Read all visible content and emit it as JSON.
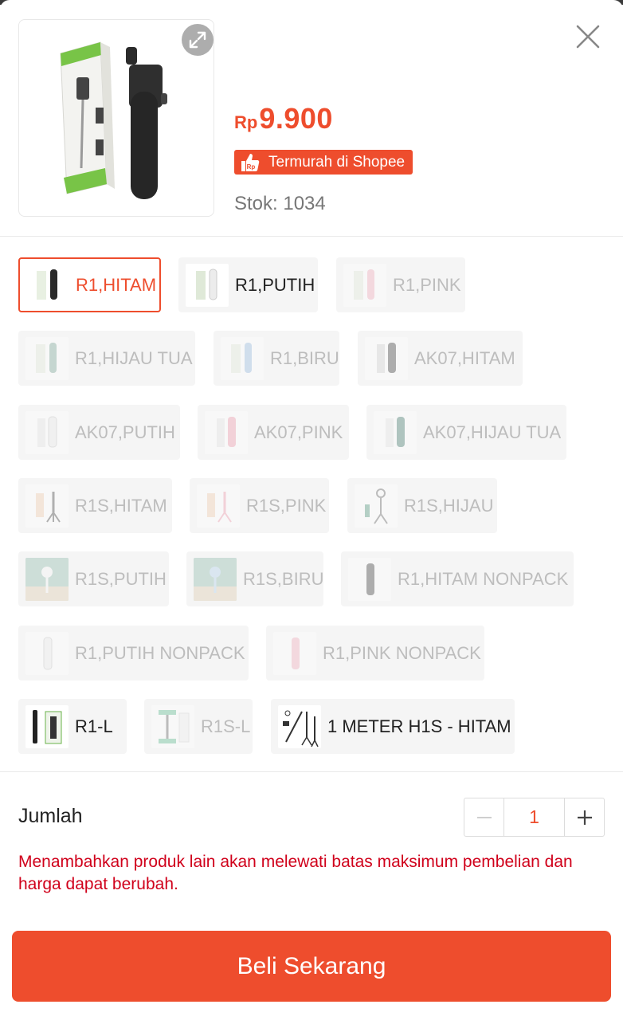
{
  "product": {
    "price_currency": "Rp",
    "price_value": "9.900",
    "badge_label": "Termurah di Shopee",
    "stock_text": "Stok: 1034"
  },
  "variations": [
    {
      "label": "R1,HITAM",
      "state": "selected"
    },
    {
      "label": "R1,PUTIH",
      "state": "available"
    },
    {
      "label": "R1,PINK",
      "state": "disabled"
    },
    {
      "label": "R1,HIJAU TUA",
      "state": "disabled"
    },
    {
      "label": "R1,BIRU",
      "state": "disabled"
    },
    {
      "label": "AK07,HITAM",
      "state": "disabled"
    },
    {
      "label": "AK07,PUTIH",
      "state": "disabled"
    },
    {
      "label": "AK07,PINK",
      "state": "disabled"
    },
    {
      "label": "AK07,HIJAU TUA",
      "state": "disabled"
    },
    {
      "label": "R1S,HITAM",
      "state": "disabled"
    },
    {
      "label": "R1S,PINK",
      "state": "disabled"
    },
    {
      "label": "R1S,HIJAU",
      "state": "disabled"
    },
    {
      "label": "R1S,PUTIH",
      "state": "disabled"
    },
    {
      "label": "R1S,BIRU",
      "state": "disabled"
    },
    {
      "label": "R1,HITAM NONPACK",
      "state": "disabled"
    },
    {
      "label": "R1,PUTIH NONPACK",
      "state": "disabled"
    },
    {
      "label": "R1,PINK NONPACK",
      "state": "disabled"
    },
    {
      "label": "R1-L",
      "state": "available"
    },
    {
      "label": "R1S-L",
      "state": "disabled"
    },
    {
      "label": "1 METER H1S - HITAM",
      "state": "available"
    }
  ],
  "quantity": {
    "label": "Jumlah",
    "value": "1",
    "minus_symbol": "−",
    "plus_symbol": "+"
  },
  "warning_text": "Menambahkan produk lain akan melewati batas maksimum pembelian dan harga dapat berubah.",
  "buy_button_label": "Beli Sekarang",
  "colors": {
    "accent": "#ee4d2d",
    "warning": "#d0011b",
    "chip_bg": "#f5f5f5"
  },
  "icons": [
    "expand-icon",
    "close-icon",
    "thumbs-up-icon",
    "minus-icon",
    "plus-icon"
  ]
}
